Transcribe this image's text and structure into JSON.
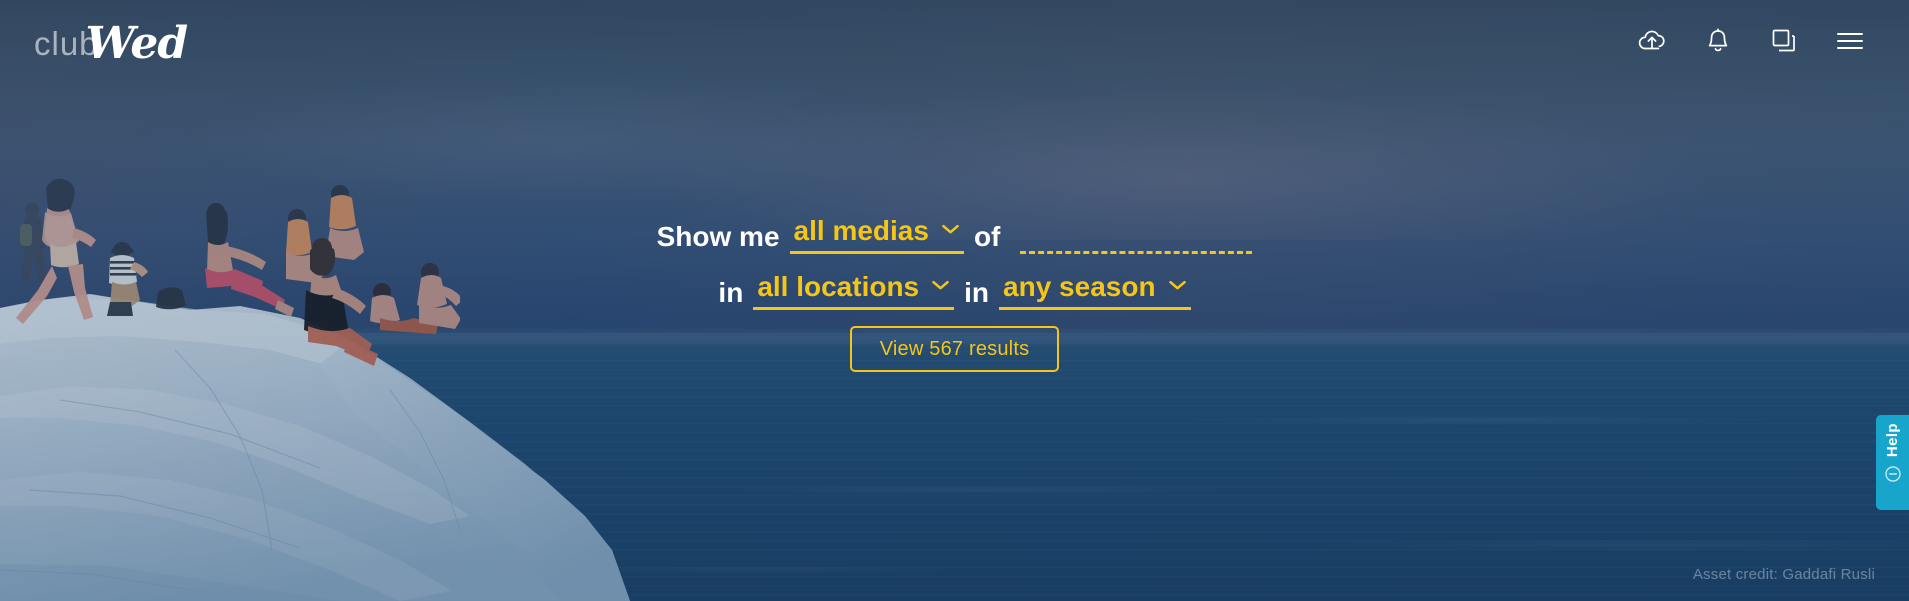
{
  "header": {
    "logo": {
      "part1": "club",
      "part2": "Wed"
    },
    "icons": [
      {
        "name": "cloud-upload-icon",
        "label": "Upload"
      },
      {
        "name": "bell-icon",
        "label": "Notifications"
      },
      {
        "name": "collections-icon",
        "label": "Collections"
      },
      {
        "name": "hamburger-menu-icon",
        "label": "Menu"
      }
    ]
  },
  "search": {
    "line1": {
      "prefix": "Show me",
      "media_type": {
        "value": "all medias",
        "chevron": "chevron-down-icon"
      },
      "connector": "of",
      "keyword": {
        "value": "",
        "placeholder": ""
      }
    },
    "line2": {
      "prefix_location": "in",
      "location": {
        "value": "all locations",
        "chevron": "chevron-down-icon"
      },
      "prefix_season": "in",
      "season": {
        "value": "any season",
        "chevron": "chevron-down-icon"
      }
    },
    "submit_label": "View 567 results",
    "result_count": 567
  },
  "help_widget": {
    "label": "Help",
    "icon": "minus-circle-icon"
  },
  "credit": {
    "text": "Asset credit: Gaddafi Rusli"
  },
  "colors": {
    "accent_yellow": "#f5c518",
    "help_cyan": "#17a5cb",
    "sky_blue": "#45607a",
    "sea_blue": "#1d486f",
    "text_white": "#ffffff"
  }
}
